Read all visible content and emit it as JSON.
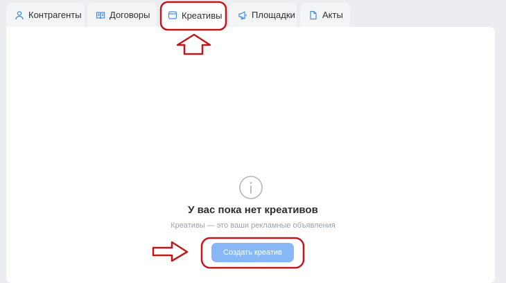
{
  "tabs": [
    {
      "label": "Контрагенты",
      "icon": "user-icon"
    },
    {
      "label": "Договоры",
      "icon": "book-icon"
    },
    {
      "label": "Креативы",
      "icon": "window-icon",
      "active": true
    },
    {
      "label": "Площадки",
      "icon": "megaphone-icon"
    },
    {
      "label": "Акты",
      "icon": "document-icon"
    }
  ],
  "empty_state": {
    "icon": "info-icon",
    "title": "У вас пока нет креативов",
    "subtitle": "Креативы — это ваши рекламные объявления",
    "button_label": "Создать креатив"
  },
  "colors": {
    "accent": "#87b7f5",
    "icon": "#3f8ae0",
    "annotation": "#c0161c",
    "background": "#ebedf0"
  }
}
